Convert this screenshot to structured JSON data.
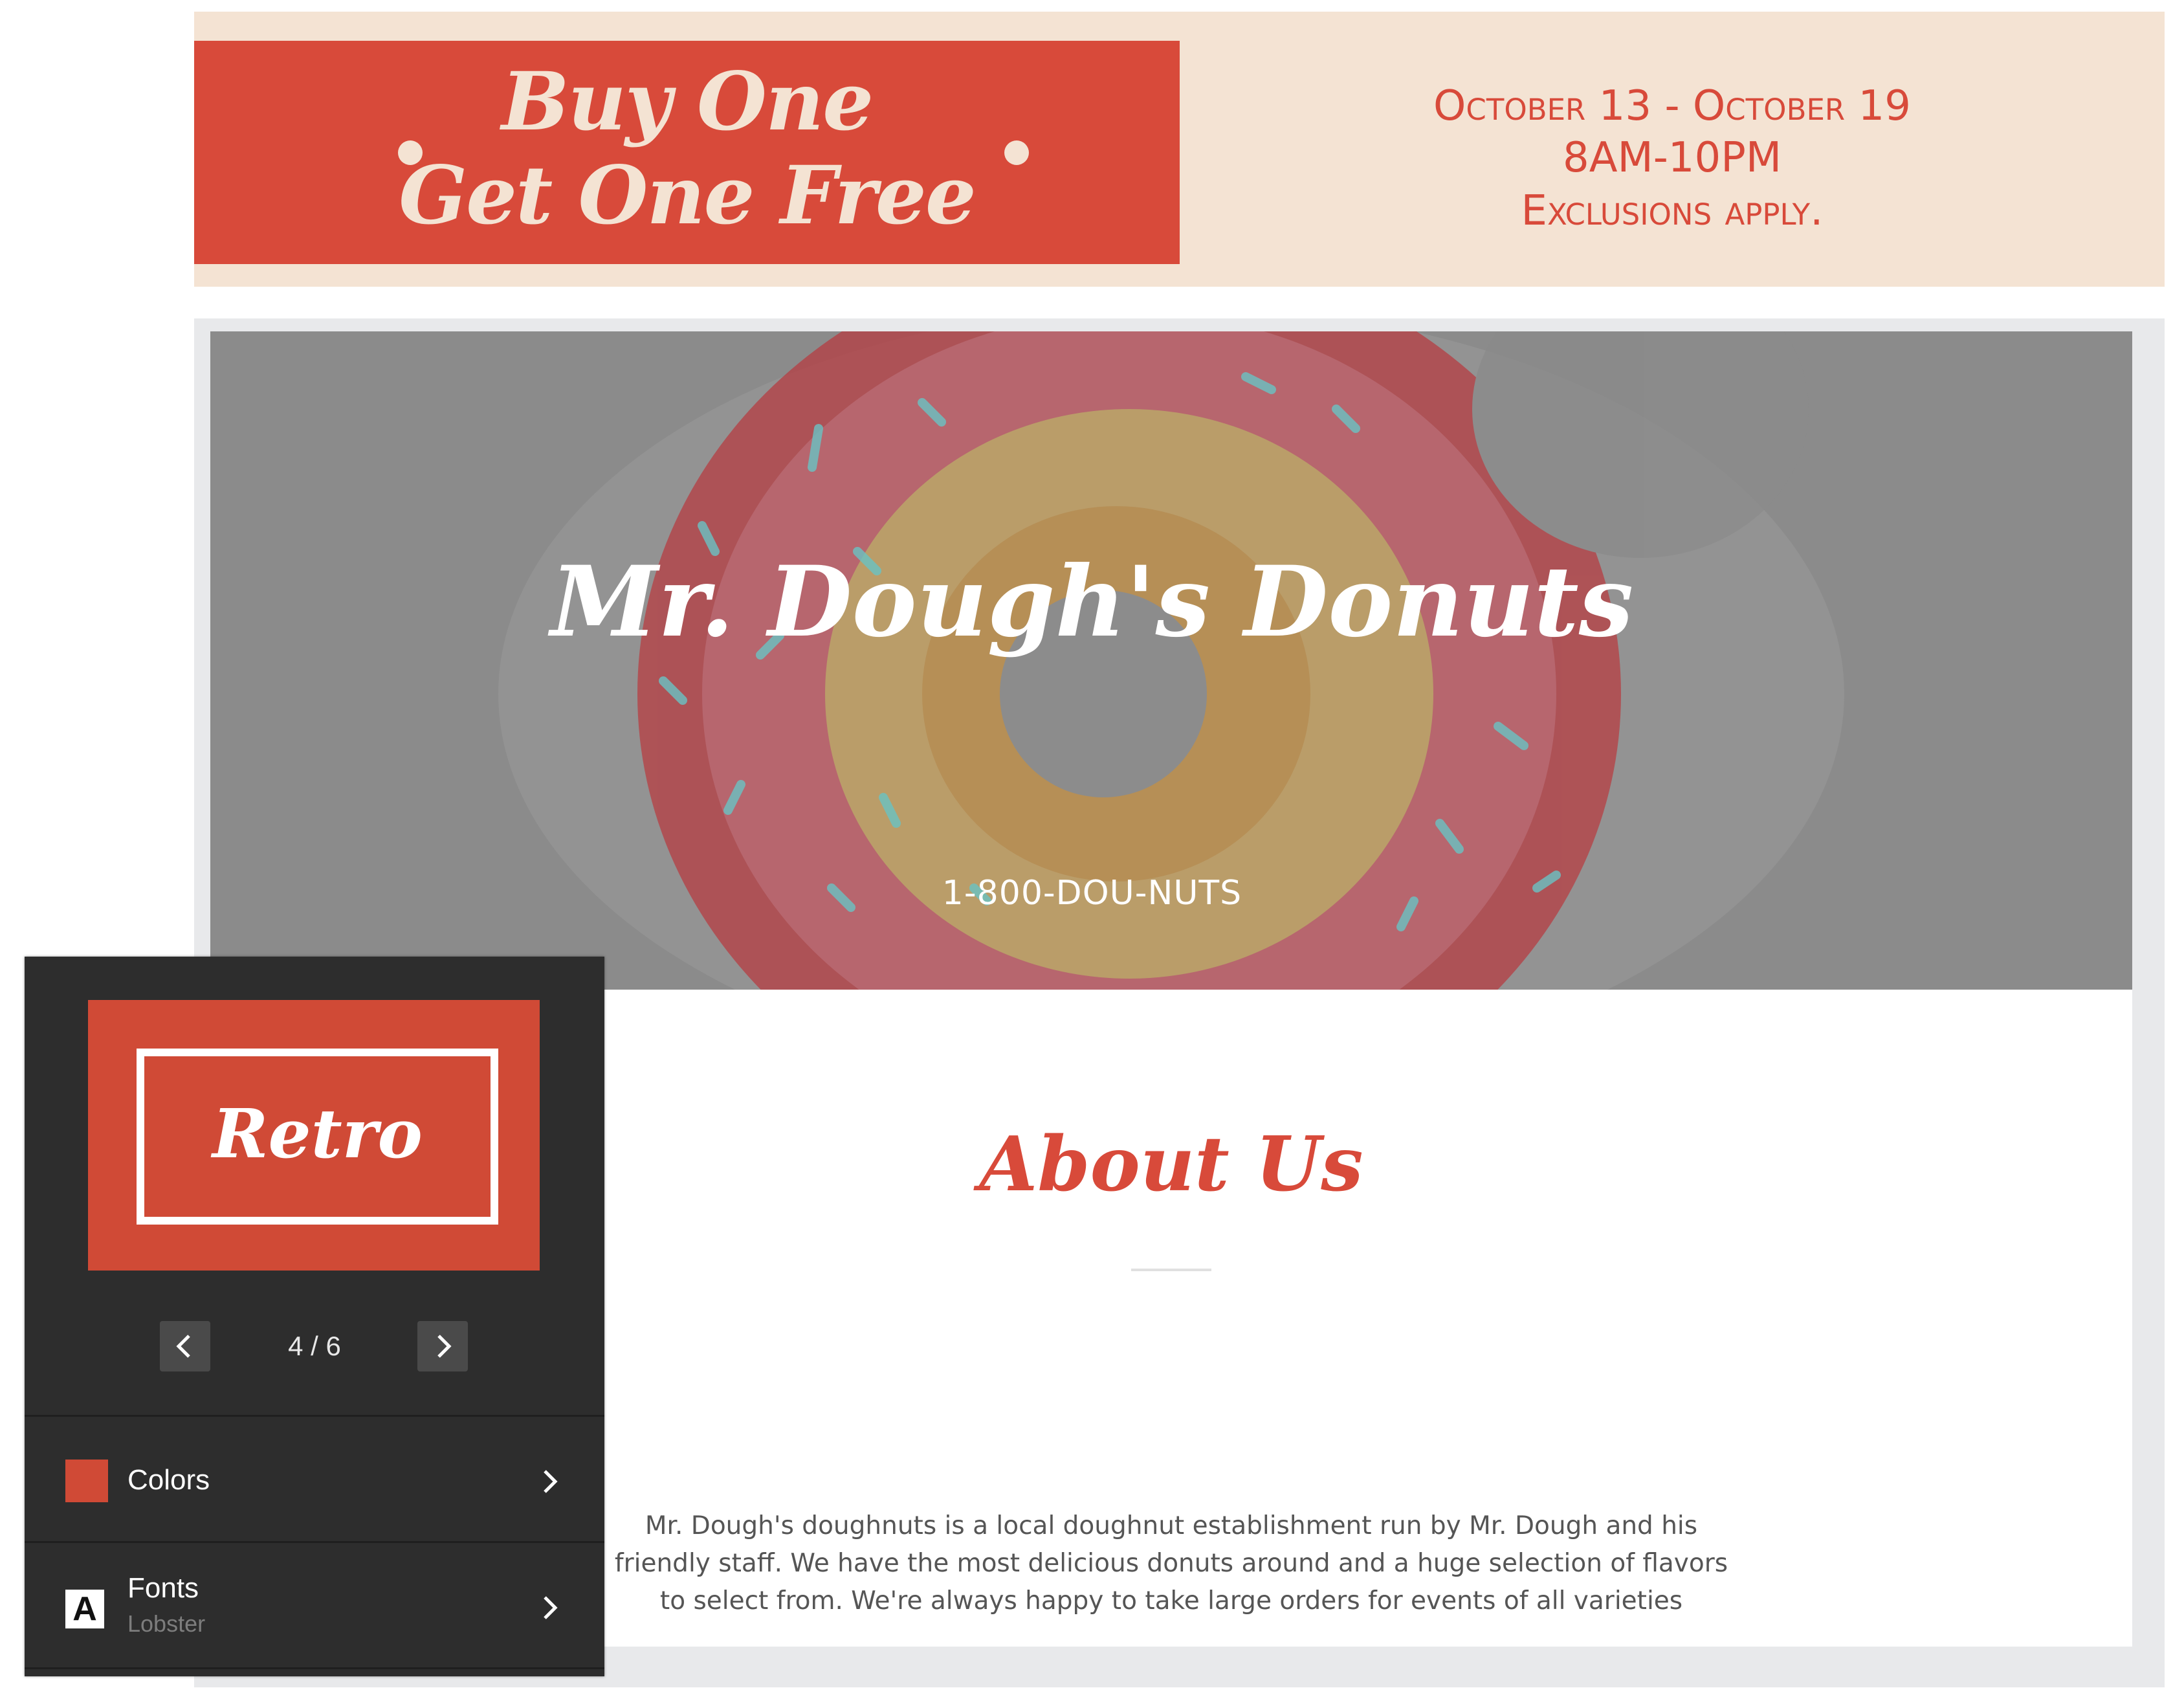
{
  "promo": {
    "line1": "Buy One",
    "line2": "Get One Free",
    "dates": "October 13 - October 19",
    "hours": "8AM-10PM",
    "note": "Exclusions apply.",
    "colors": {
      "accent": "#d84a3a",
      "cream": "#f4e3d3"
    }
  },
  "hero": {
    "title": "Mr. Dough's Donuts",
    "phone": "1-800-DOU-NUTS"
  },
  "about": {
    "title": "About Us",
    "text": "Mr. Dough's doughnuts is a local doughnut establishment run by Mr. Dough and his friendly staff. We have the most delicious donuts around and a huge selection of flavors to select from. We're always happy to take large orders for events of all varieties"
  },
  "theme_panel": {
    "preview_label": "Retro",
    "pager": "4 / 6",
    "prev_icon": "chevron-left-icon",
    "next_icon": "chevron-right-icon",
    "colors_row": {
      "label": "Colors",
      "swatch": "#d04a36"
    },
    "fonts_row": {
      "label": "Fonts",
      "value": "Lobster",
      "icon_glyph": "A"
    }
  }
}
